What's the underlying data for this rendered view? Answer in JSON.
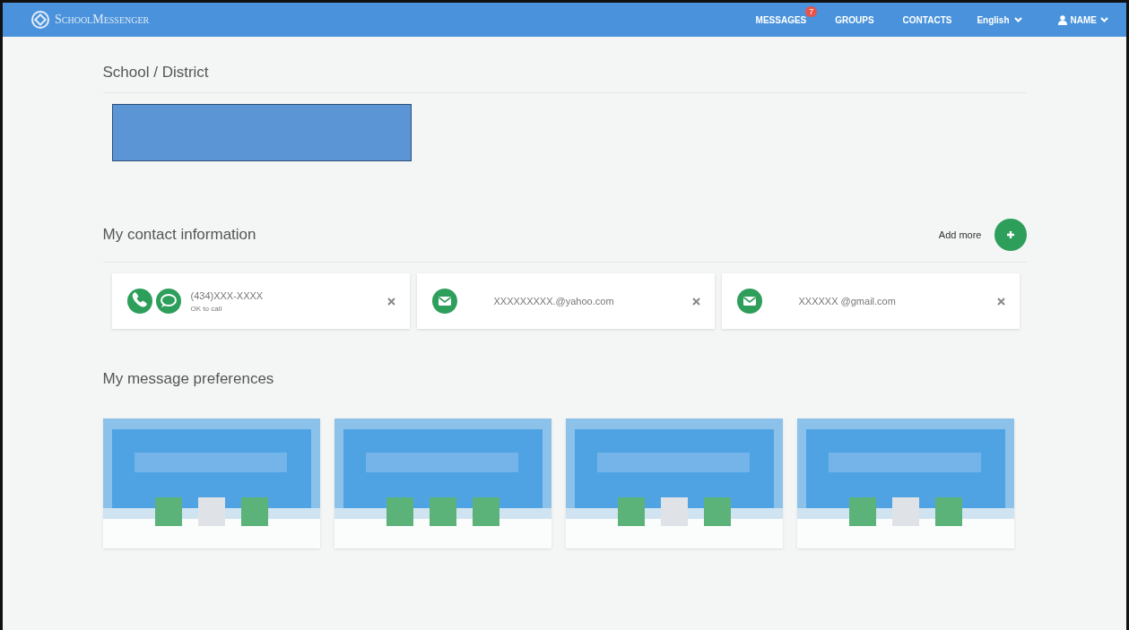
{
  "navbar": {
    "brand": "SchoolMessenger",
    "links": [
      {
        "label": "MESSAGES",
        "badge": "7"
      },
      {
        "label": "GROUPS"
      },
      {
        "label": "CONTACTS"
      }
    ],
    "language": "English",
    "user": "NAME"
  },
  "school_section": {
    "title": "School / District"
  },
  "contact_section": {
    "title": "My contact information",
    "add_label": "Add more",
    "contacts": [
      {
        "kind": "phone",
        "value": "(434)XXX-XXXX",
        "note": "OK to call"
      },
      {
        "kind": "email",
        "value": "XXXXXXXXX.@yahoo.com"
      },
      {
        "kind": "email",
        "value": "XXXXXX @gmail.com"
      }
    ]
  },
  "preferences_section": {
    "title": "My message preferences",
    "cards": [
      {
        "channels": [
          {
            "on": true
          },
          {
            "on": false
          },
          {
            "on": true
          }
        ]
      },
      {
        "channels": [
          {
            "on": true
          },
          {
            "on": true
          },
          {
            "on": true
          }
        ]
      },
      {
        "channels": [
          {
            "on": true
          },
          {
            "on": false
          },
          {
            "on": true
          }
        ]
      },
      {
        "channels": [
          {
            "on": true
          },
          {
            "on": false
          },
          {
            "on": true
          }
        ]
      }
    ]
  }
}
